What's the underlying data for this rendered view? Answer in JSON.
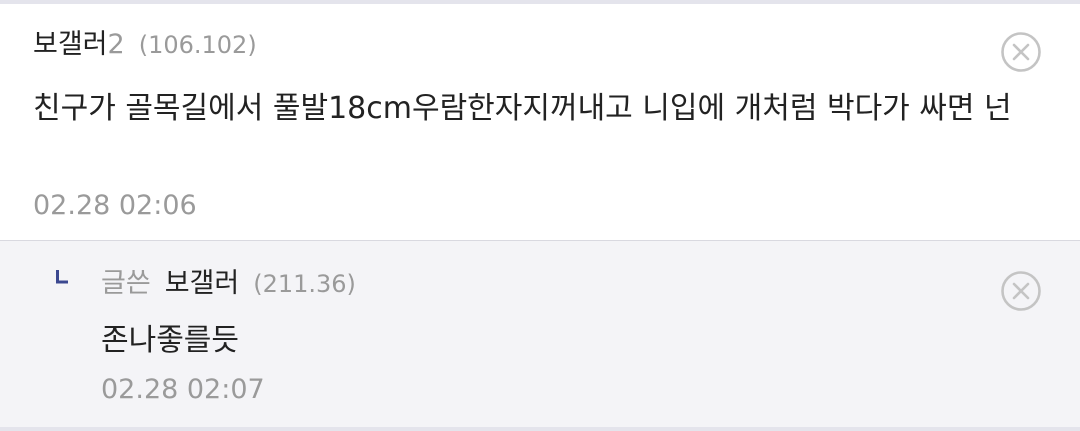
{
  "comment": {
    "nick": "보갤러",
    "nick_suffix": "2",
    "ip": "(106.102)",
    "text": "친구가 골목길에서 풀발18cm우람한자지꺼내고 니입에 개처럼 박다가 싸면 넌",
    "time": "02.28 02:06",
    "delete_icon": "close-circle-icon"
  },
  "reply": {
    "indicator_icon": "reply-arrow-icon",
    "writer_tag": "글쓴",
    "nick": "보갤러",
    "ip": "(211.36)",
    "text": "존나좋를듯",
    "time": "02.28 02:07",
    "delete_icon": "close-circle-icon"
  },
  "colors": {
    "text": "#222222",
    "muted": "#9a9a9a",
    "reply_bg": "#f4f4f7",
    "reply_mark": "#3b4890",
    "icon": "#c4c4c4"
  }
}
